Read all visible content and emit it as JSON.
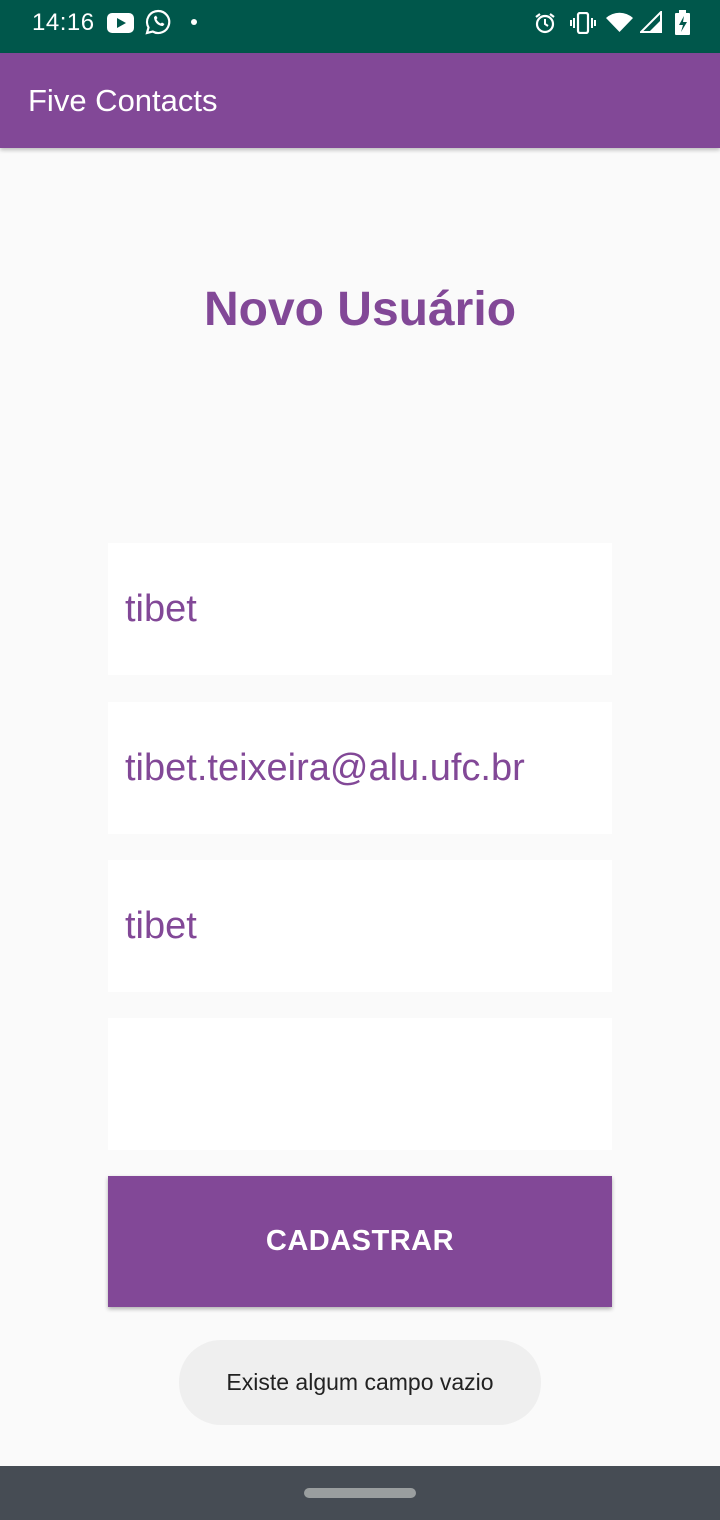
{
  "status_bar": {
    "time": "14:16",
    "left_icons": [
      "youtube-icon",
      "whatsapp-icon",
      "notification-dot-icon"
    ],
    "right_icons": [
      "alarm-icon",
      "vibrate-icon",
      "wifi-icon",
      "signal-icon",
      "battery-charging-icon"
    ]
  },
  "app_bar": {
    "title": "Five Contacts"
  },
  "colors": {
    "primary": "#824897",
    "status_bar": "#00574b",
    "background": "#fafafa",
    "nav_bar": "#464c54",
    "toast_bg": "#efefef"
  },
  "form": {
    "title": "Novo Usuário",
    "fields": [
      {
        "value": "tibet"
      },
      {
        "value": "tibet.teixeira@alu.ufc.br"
      },
      {
        "value": "tibet"
      },
      {
        "value": ""
      }
    ],
    "submit_label": "CADASTRAR"
  },
  "toast": {
    "message": "Existe algum campo vazio"
  }
}
